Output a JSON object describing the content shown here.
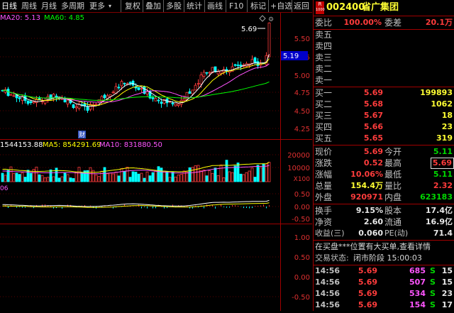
{
  "toolbar": {
    "period_tabs": [
      "日线",
      "周线",
      "月线",
      "多周期",
      "更多"
    ],
    "more_arrow": "▾",
    "tools": [
      "复权",
      "叠加",
      "多股",
      "统计",
      "画线",
      "F10",
      "标记",
      "+自选",
      "返回"
    ]
  },
  "price_chart": {
    "ma_legend": [
      {
        "text": "MA20: 5.13",
        "color": "#ff55ff"
      },
      {
        "text": "MA60: 4.85",
        "color": "#00ff00"
      }
    ],
    "y_ticks": [
      "5.50",
      "5.25",
      "5.00",
      "4.75",
      "4.50",
      "4.25"
    ],
    "current_price_tag": "5.19",
    "high_label": "5.69"
  },
  "volume_chart": {
    "legend": [
      {
        "text": "1544153.88",
        "color": "#ffffff"
      },
      {
        "text": "MA5: 854291.69",
        "color": "#ffff00"
      },
      {
        "text": "MA10: 831880.50",
        "color": "#ff55ff"
      }
    ],
    "y_ticks": [
      "20000",
      "10000"
    ],
    "unit": "X100"
  },
  "indicator_chart": {
    "label": "06",
    "y_ticks": [
      "0.50",
      "0.00",
      "-0.50"
    ]
  },
  "empty_chart": {
    "y_ticks": [
      "1.00",
      "0.50",
      "0.00",
      "-0.50"
    ]
  },
  "caiwu_badge": "财",
  "quote": {
    "logo_top": "R",
    "logo_bottom": "1000",
    "code": "002400",
    "name": "省广集团",
    "weibi_label": "委比",
    "weibi_value": "100.00%",
    "weicha_label": "委差",
    "weicha_value": "20.1万",
    "asks": [
      {
        "label": "卖五",
        "price": "",
        "vol": ""
      },
      {
        "label": "卖四",
        "price": "",
        "vol": ""
      },
      {
        "label": "卖三",
        "price": "",
        "vol": ""
      },
      {
        "label": "卖二",
        "price": "",
        "vol": ""
      },
      {
        "label": "卖一",
        "price": "",
        "vol": ""
      }
    ],
    "bids": [
      {
        "label": "买一",
        "price": "5.69",
        "vol": "199893"
      },
      {
        "label": "买二",
        "price": "5.68",
        "vol": "1062"
      },
      {
        "label": "买三",
        "price": "5.67",
        "vol": "18"
      },
      {
        "label": "买四",
        "price": "5.66",
        "vol": "23"
      },
      {
        "label": "买五",
        "price": "5.65",
        "vol": "319"
      }
    ],
    "stats": [
      {
        "l1": "现价",
        "v1": "5.69",
        "c1": "red",
        "l2": "今开",
        "v2": "5.11",
        "c2": "green"
      },
      {
        "l1": "涨跌",
        "v1": "0.52",
        "c1": "red",
        "l2": "最高",
        "v2": "5.69",
        "c2": "red",
        "boxed": true
      },
      {
        "l1": "涨幅",
        "v1": "10.06%",
        "c1": "red",
        "l2": "最低",
        "v2": "5.11",
        "c2": "green"
      },
      {
        "l1": "总量",
        "v1": "154.4万",
        "c1": "yellow",
        "l2": "量比",
        "v2": "2.32",
        "c2": "red"
      },
      {
        "l1": "外盘",
        "v1": "920971",
        "c1": "red",
        "l2": "内盘",
        "v2": "623183",
        "c2": "green"
      }
    ],
    "stats2": [
      {
        "l1": "换手",
        "v1": "9.15%",
        "l2": "股本",
        "v2": "17.4亿"
      },
      {
        "l1": "净资",
        "v1": "2.60",
        "l2": "流通",
        "v2": "16.9亿"
      },
      {
        "l1": "收益(三)",
        "v1": "0.060",
        "l2": "PE(动)",
        "v2": "71.4"
      }
    ],
    "notice": "在买盘***位置有大买单,查看详情",
    "status_label": "交易状态:",
    "status_value": "闭市阶段 15:00:03",
    "ticks": [
      {
        "time": "14:56",
        "price": "5.69",
        "vol": "685",
        "side": "S",
        "num": "15"
      },
      {
        "time": "14:56",
        "price": "5.69",
        "vol": "507",
        "side": "S",
        "num": "15"
      },
      {
        "time": "14:56",
        "price": "5.69",
        "vol": "534",
        "side": "S",
        "num": "23"
      },
      {
        "time": "14:56",
        "price": "5.69",
        "vol": "154",
        "side": "S",
        "num": "17"
      }
    ]
  }
}
